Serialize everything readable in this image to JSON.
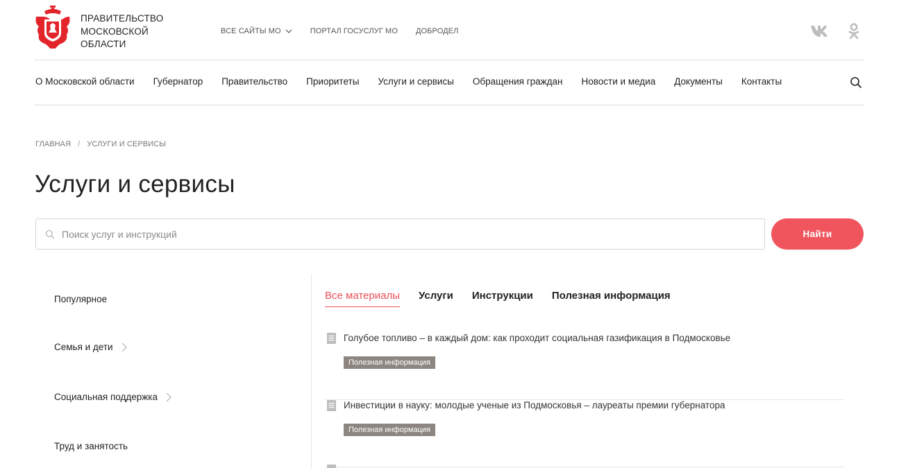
{
  "header": {
    "org_name_lines": [
      "ПРАВИТЕЛЬСТВО",
      "МОСКОВСКОЙ",
      "ОБЛАСТИ"
    ],
    "top_links": [
      {
        "label": "ВСЕ САЙТЫ МО",
        "has_dropdown": true
      },
      {
        "label": "ПОРТАЛ ГОСУСЛУГ МО"
      },
      {
        "label": "ДОБРОДЕЛ"
      }
    ],
    "social": [
      "vk-icon",
      "odnoklassniki-icon"
    ]
  },
  "nav": {
    "items": [
      "О Московской области",
      "Губернатор",
      "Правительство",
      "Приоритеты",
      "Услуги и сервисы",
      "Обращения граждан",
      "Новости и медиа",
      "Документы",
      "Контакты"
    ]
  },
  "breadcrumb": {
    "items": [
      "ГЛАВНАЯ",
      "УСЛУГИ И СЕРВИСЫ"
    ],
    "separator": "/"
  },
  "page": {
    "title": "Услуги и сервисы"
  },
  "search": {
    "placeholder": "Поиск услуг и инструкций",
    "value": "",
    "button": "Найти"
  },
  "sidebar": {
    "items": [
      {
        "label": "Популярное",
        "has_arrow": false
      },
      {
        "label": "Семья и дети",
        "has_arrow": true
      },
      {
        "label": "Социальная поддержка",
        "has_arrow": true
      },
      {
        "label": "Труд и занятость",
        "has_arrow": false
      }
    ]
  },
  "tabs": {
    "items": [
      "Все материалы",
      "Услуги",
      "Инструкции",
      "Полезная информация"
    ],
    "active": 0
  },
  "materials": [
    {
      "title": "Голубое топливо – в каждый дом: как проходит социальная газификация в Подмосковье",
      "badge": "Полезная информация"
    },
    {
      "title": "Инвестиции в науку: молодые ученые из Подмосковья – лауреаты премии губернатора",
      "badge": "Полезная информация"
    }
  ],
  "colors": {
    "accent": "#f0555e",
    "badge_bg": "#8d8680",
    "logo_red": "#e3242b"
  }
}
